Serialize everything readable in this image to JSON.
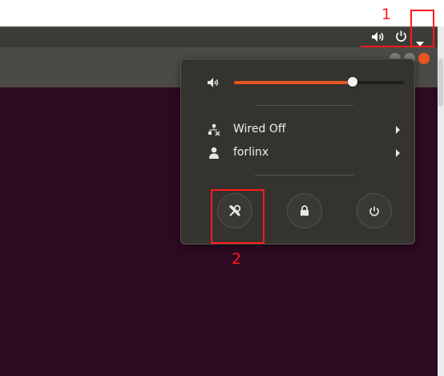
{
  "topbar": {
    "icons": [
      "speaker-icon",
      "power-icon",
      "dropdown-arrow-icon"
    ]
  },
  "menu": {
    "volume": {
      "icon": "speaker-icon",
      "level": 0.7
    },
    "network": {
      "label": "Wired Off",
      "icon": "wired-network-icon"
    },
    "user": {
      "label": "forlinx",
      "icon": "user-icon"
    },
    "actions": [
      "settings-icon",
      "lock-icon",
      "power-icon"
    ]
  },
  "annotations": {
    "step1": "1",
    "step2": "2"
  },
  "colors": {
    "accent": "#e95420",
    "annotation": "#ff1a1a",
    "desktop": "#2d0922",
    "panel": "#34332f"
  }
}
